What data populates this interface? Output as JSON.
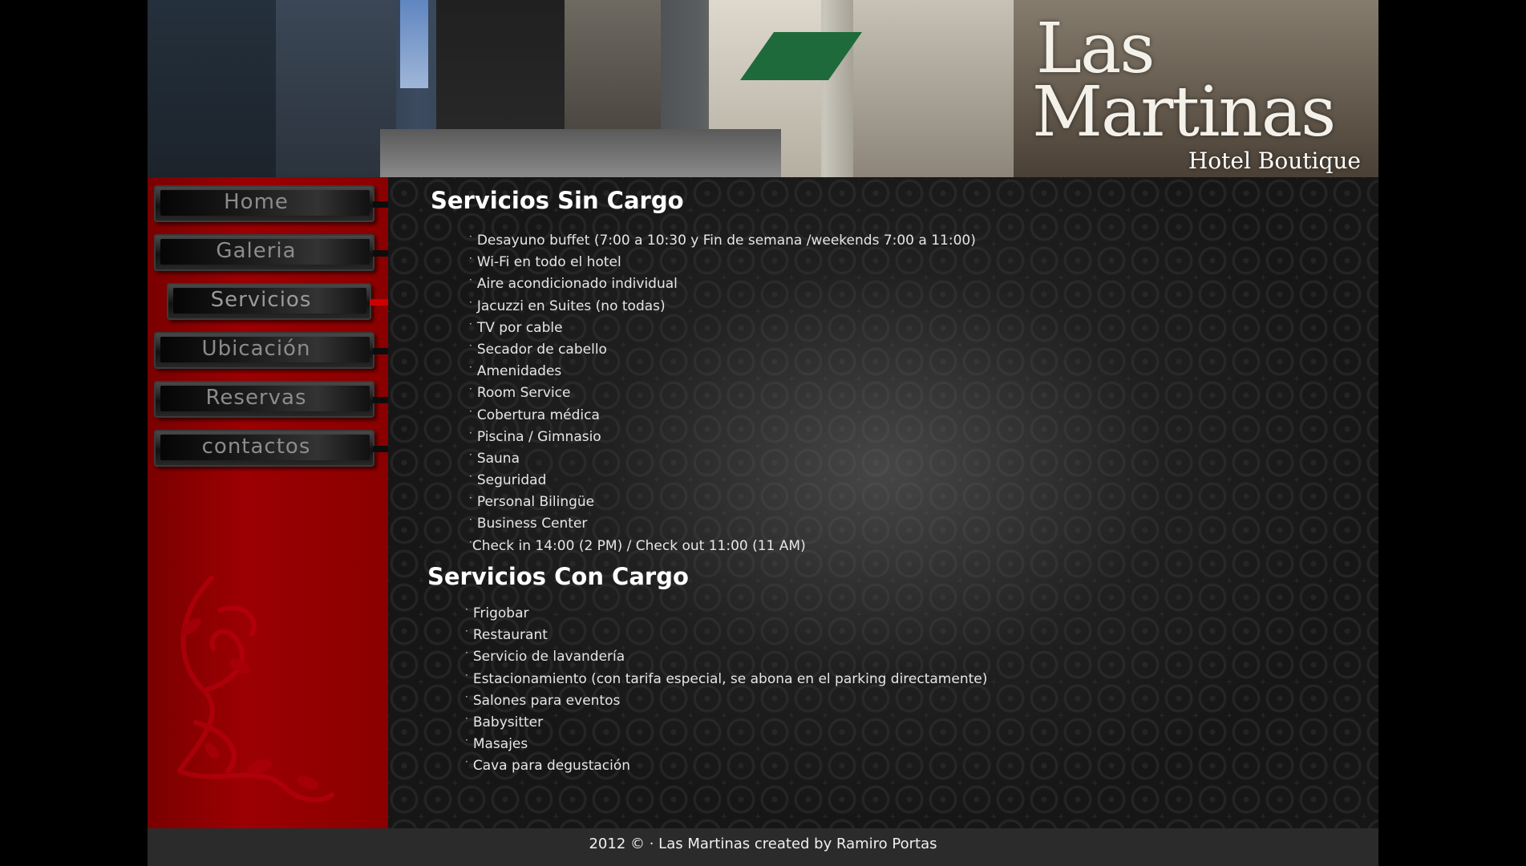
{
  "header": {
    "logo_line1": "Las",
    "logo_line2": "Martinas",
    "logo_tagline": "Hotel Boutique"
  },
  "nav": {
    "items": [
      {
        "label": "Home",
        "active": false
      },
      {
        "label": "Galeria",
        "active": false
      },
      {
        "label": "Servicios",
        "active": true
      },
      {
        "label": "Ubicación",
        "active": false
      },
      {
        "label": "Reservas",
        "active": false
      },
      {
        "label": "contactos",
        "active": false
      }
    ]
  },
  "free_services": {
    "title": "Servicios Sin Cargo",
    "items": [
      "Desayuno buffet (7:00 a 10:30 y Fin de semana /weekends 7:00 a 11:00)",
      "Wi-Fi en todo el hotel",
      "Aire acondicionado individual",
      "Jacuzzi en Suites (no todas)",
      "TV por cable",
      "Secador de cabello",
      "Amenidades",
      "Room Service",
      "Cobertura médica",
      "Piscina / Gimnasio",
      "Sauna",
      "Seguridad",
      "Personal Bilingüe",
      "Business Center"
    ],
    "checkin_note": "Check in 14:00 (2 PM) / Check out 11:00 (11 AM)"
  },
  "paid_services": {
    "title": "Servicios Con Cargo",
    "items": [
      "Frigobar",
      "Restaurant",
      "Servicio de lavandería",
      "Estacionamiento (con tarifa especial, se abona en el parking directamente)",
      "Salones para eventos",
      "Babysitter",
      "Masajes",
      "Cava para degustación"
    ]
  },
  "footer": {
    "text": "2012 © · Las Martinas created by Ramiro Portas"
  },
  "colors": {
    "sidebar_red": "#9c0003",
    "footer_bg": "#2b2b2b",
    "content_bg": "#161616"
  }
}
